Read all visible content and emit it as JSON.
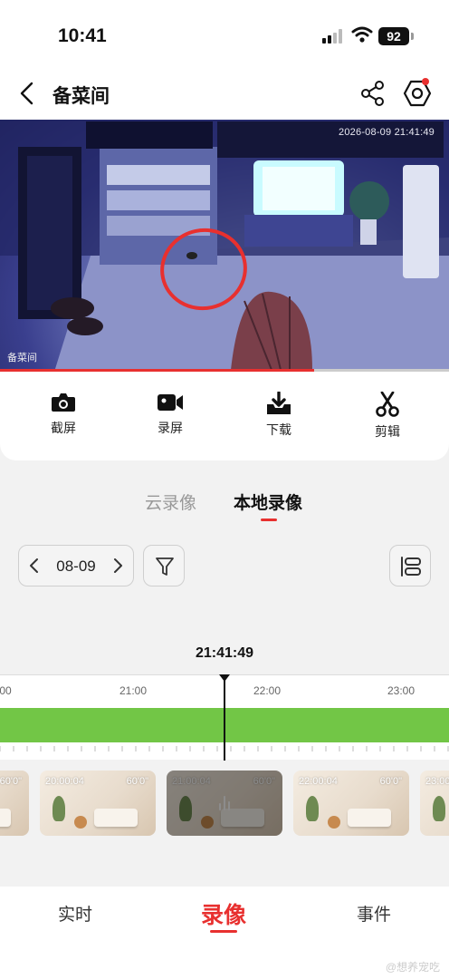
{
  "status": {
    "time": "10:41",
    "battery": "92"
  },
  "nav": {
    "title": "备菜间"
  },
  "video": {
    "timestamp": "2026-08-09 21:41:49",
    "label": "备菜间",
    "progress": 0.7
  },
  "tools": [
    {
      "label": "截屏",
      "icon": "camera-icon"
    },
    {
      "label": "录屏",
      "icon": "video-camera-icon"
    },
    {
      "label": "下载",
      "icon": "download-icon"
    },
    {
      "label": "剪辑",
      "icon": "scissors-icon"
    }
  ],
  "tabs": {
    "cloud": "云录像",
    "local": "本地录像",
    "selected": "本地录像"
  },
  "date": {
    "value": "08-09"
  },
  "timeline": {
    "current": "21:41:49",
    "hours": [
      ":00",
      "21:00",
      "22:00",
      "23:00"
    ]
  },
  "thumbs": [
    {
      "start": "",
      "duration": "60'0\""
    },
    {
      "start": "20:00:04",
      "duration": "60'0\""
    },
    {
      "start": "21:00:04",
      "duration": "60'0\""
    },
    {
      "start": "22:00:04",
      "duration": "60'0\""
    },
    {
      "start": "23:00",
      "duration": ""
    }
  ],
  "bottomnav": {
    "live": "实时",
    "recording": "录像",
    "events": "事件",
    "selected": "录像"
  },
  "watermark": "@想养宠吃",
  "colors": {
    "accent": "#e8302f",
    "recordingBar": "#72c646"
  }
}
